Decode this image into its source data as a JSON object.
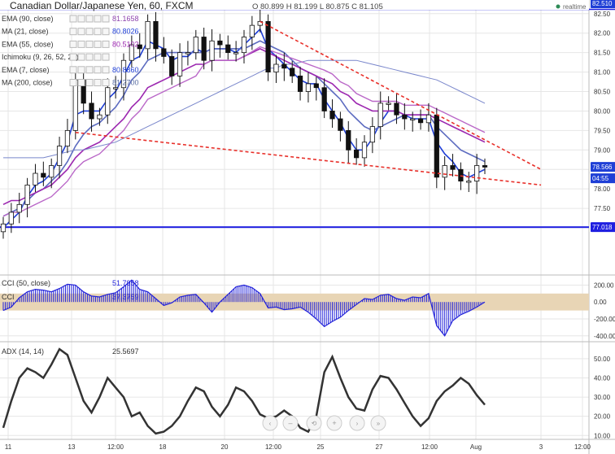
{
  "header": {
    "title": "Canadian Dollar/Japanese Yen, 60, FXCM",
    "ohlc_text": "O 80.899  H 81.199  L 80.875  C 81.105",
    "realtime_label": "realtime"
  },
  "indicators": [
    {
      "label": "EMA (90, close)",
      "value": "81.1658",
      "color": "#8e44ad"
    },
    {
      "label": "MA (21, close)",
      "value": "80.8026",
      "color": "#1f3fd6"
    },
    {
      "label": "EMA (55, close)",
      "value": "80.5102",
      "color": "#9c27b0"
    },
    {
      "label": "Ichimoku (9, 26, 52, 26)",
      "value": "",
      "color": "#999999"
    },
    {
      "label": "EMA (7, close)",
      "value": "80.8860",
      "color": "#1f3fd6"
    },
    {
      "label": "MA (200, close)",
      "value": "81.2700",
      "color": "#5b6fa3"
    }
  ],
  "price_badges": {
    "top": "82.510",
    "current": "78.566",
    "countdown": "04:55",
    "support": "77.018"
  },
  "cci": {
    "label": "CCI (50, close)",
    "value": "51.7958",
    "label2": "CCI",
    "value2": "37.3759"
  },
  "adx": {
    "label": "ADX (14, 14)",
    "value": "25.5697"
  },
  "colors": {
    "candle_up": "#111111",
    "candle_down": "#111111",
    "ema7": "#1f3fd6",
    "ma21": "#5c6bc0",
    "ema55": "#9c27b0",
    "ema90": "#ba68c8",
    "ma200": "#7986cb",
    "trendline": "#e8302a",
    "support_line": "#1f1fe0",
    "cci_band": "#e8d5b5",
    "cci_bars": "#2323d9",
    "adx_line": "#333333",
    "grid": "#e6e6e6"
  },
  "chart_data": [
    {
      "type": "line",
      "title": "Canadian Dollar/Japanese Yen, 60, FXCM",
      "x": [
        0,
        1,
        2,
        3,
        4,
        5,
        6,
        7,
        8,
        9,
        10,
        11,
        12,
        13,
        14,
        15,
        16,
        17,
        18,
        19,
        20,
        21,
        22,
        23,
        24,
        25,
        26,
        27,
        28,
        29,
        30,
        31,
        32,
        33,
        34,
        35,
        36,
        37,
        38,
        39,
        40,
        41,
        42,
        43,
        44,
        45,
        46,
        47,
        48,
        49,
        50,
        51,
        52,
        53,
        54,
        55,
        56,
        57,
        58,
        59,
        60
      ],
      "x_tick_labels": [
        "11",
        "13",
        "12:00",
        "18",
        "20",
        "12:00",
        "25",
        "27",
        "12:00",
        "Aug",
        "3",
        "12:00"
      ],
      "ylim": [
        76.75,
        82.6
      ],
      "y_ticks": [
        77.0,
        77.5,
        78.0,
        78.5,
        79.0,
        79.5,
        80.0,
        80.5,
        81.0,
        81.5,
        82.0,
        82.5
      ],
      "series": [
        {
          "name": "close",
          "values": [
            77.1,
            77.4,
            77.6,
            78.1,
            78.4,
            78.3,
            78.6,
            79.1,
            79.5,
            80.8,
            80.2,
            79.8,
            79.9,
            80.6,
            80.6,
            81.3,
            81.7,
            81.6,
            82.3,
            81.6,
            81.4,
            80.9,
            81.5,
            81.5,
            81.9,
            81.3,
            81.8,
            81.7,
            81.5,
            81.5,
            81.9,
            82.2,
            82.3,
            81.0,
            81.2,
            81.1,
            80.9,
            80.5,
            80.7,
            80.6,
            80.0,
            79.8,
            79.5,
            79.0,
            78.8,
            79.2,
            79.6,
            80.2,
            80.2,
            79.9,
            79.8,
            79.8,
            79.7,
            79.9,
            78.3,
            78.6,
            78.5,
            78.2,
            78.2,
            78.6,
            78.56
          ]
        },
        {
          "name": "EMA (7, close)",
          "values": [
            77.0,
            77.2,
            77.4,
            77.8,
            78.1,
            78.2,
            78.4,
            78.8,
            79.2,
            79.9,
            80.0,
            80.0,
            80.0,
            80.3,
            80.5,
            80.9,
            81.3,
            81.4,
            81.8,
            81.7,
            81.6,
            81.3,
            81.4,
            81.4,
            81.6,
            81.5,
            81.6,
            81.6,
            81.6,
            81.5,
            81.7,
            81.9,
            82.1,
            81.6,
            81.4,
            81.2,
            81.0,
            80.8,
            80.7,
            80.7,
            80.3,
            80.0,
            79.7,
            79.3,
            79.0,
            79.0,
            79.3,
            79.7,
            80.0,
            80.0,
            79.9,
            79.8,
            79.8,
            79.8,
            79.2,
            78.9,
            78.7,
            78.4,
            78.3,
            78.4,
            78.5
          ]
        },
        {
          "name": "MA (21, close)",
          "values": [
            77.3,
            77.4,
            77.5,
            77.7,
            77.9,
            78.0,
            78.2,
            78.4,
            78.7,
            79.1,
            79.4,
            79.6,
            79.7,
            79.9,
            80.1,
            80.4,
            80.8,
            81.0,
            81.3,
            81.4,
            81.5,
            81.5,
            81.5,
            81.5,
            81.5,
            81.5,
            81.6,
            81.6,
            81.6,
            81.6,
            81.6,
            81.7,
            81.8,
            81.7,
            81.6,
            81.5,
            81.3,
            81.1,
            81.0,
            80.9,
            80.7,
            80.5,
            80.3,
            80.0,
            79.8,
            79.6,
            79.5,
            79.6,
            79.7,
            79.8,
            79.9,
            79.9,
            79.9,
            79.9,
            79.6,
            79.4,
            79.2,
            79.0,
            78.9,
            78.8,
            78.7
          ]
        },
        {
          "name": "EMA (55, close)",
          "values": [
            77.6,
            77.7,
            77.7,
            77.8,
            77.9,
            78.0,
            78.1,
            78.3,
            78.5,
            78.8,
            79.0,
            79.1,
            79.2,
            79.4,
            79.6,
            79.8,
            80.1,
            80.3,
            80.6,
            80.7,
            80.8,
            80.9,
            81.0,
            81.1,
            81.2,
            81.2,
            81.3,
            81.3,
            81.3,
            81.3,
            81.4,
            81.5,
            81.6,
            81.5,
            81.4,
            81.3,
            81.2,
            81.1,
            81.0,
            80.9,
            80.8,
            80.7,
            80.5,
            80.4,
            80.2,
            80.1,
            80.0,
            80.0,
            80.0,
            80.0,
            79.9,
            79.9,
            79.9,
            79.9,
            79.8,
            79.7,
            79.6,
            79.5,
            79.4,
            79.3,
            79.2
          ]
        },
        {
          "name": "MA (200, close)",
          "values": [
            78.8,
            78.8,
            78.8,
            78.8,
            78.8,
            78.8,
            78.85,
            78.9,
            78.95,
            79.0,
            79.0,
            79.05,
            79.1,
            79.15,
            79.2,
            79.3,
            79.4,
            79.5,
            79.6,
            79.7,
            79.8,
            79.9,
            80.0,
            80.1,
            80.2,
            80.3,
            80.4,
            80.5,
            80.6,
            80.7,
            80.8,
            80.9,
            81.0,
            81.1,
            81.1,
            81.2,
            81.2,
            81.25,
            81.3,
            81.3,
            81.3,
            81.3,
            81.3,
            81.3,
            81.3,
            81.25,
            81.2,
            81.15,
            81.1,
            81.05,
            81.0,
            80.95,
            80.9,
            80.85,
            80.8,
            80.7,
            80.6,
            80.5,
            80.4,
            80.3,
            80.2
          ]
        }
      ],
      "annotations": [
        {
          "type": "trendline",
          "from": [
            32,
            82.3
          ],
          "to": [
            67,
            78.5
          ]
        },
        {
          "type": "trendline",
          "from": [
            9,
            79.45
          ],
          "to": [
            67,
            78.1
          ]
        },
        {
          "type": "hline",
          "y": 77.018
        }
      ]
    },
    {
      "type": "bar",
      "title": "CCI (50, close)",
      "x": [
        0,
        1,
        2,
        3,
        4,
        5,
        6,
        7,
        8,
        9,
        10,
        11,
        12,
        13,
        14,
        15,
        16,
        17,
        18,
        19,
        20,
        21,
        22,
        23,
        24,
        25,
        26,
        27,
        28,
        29,
        30,
        31,
        32,
        33,
        34,
        35,
        36,
        37,
        38,
        39,
        40,
        41,
        42,
        43,
        44,
        45,
        46,
        47,
        48,
        49,
        50,
        51,
        52,
        53,
        54,
        55,
        56,
        57,
        58,
        59,
        60
      ],
      "ylim": [
        -450,
        300
      ],
      "y_ticks": [
        -400,
        -200,
        0,
        200
      ],
      "band": [
        -100,
        100
      ],
      "values": [
        -100,
        -60,
        50,
        120,
        150,
        140,
        120,
        160,
        210,
        200,
        120,
        70,
        60,
        90,
        110,
        180,
        260,
        150,
        120,
        40,
        -40,
        -10,
        60,
        80,
        90,
        -10,
        -120,
        0,
        90,
        180,
        200,
        170,
        100,
        -70,
        -60,
        -90,
        -80,
        -60,
        -120,
        -200,
        -290,
        -230,
        -180,
        -100,
        -30,
        40,
        30,
        80,
        90,
        40,
        20,
        60,
        50,
        100,
        -280,
        -400,
        -220,
        -150,
        -110,
        -60,
        0
      ]
    },
    {
      "type": "line",
      "title": "ADX (14, 14)",
      "x": [
        0,
        1,
        2,
        3,
        4,
        5,
        6,
        7,
        8,
        9,
        10,
        11,
        12,
        13,
        14,
        15,
        16,
        17,
        18,
        19,
        20,
        21,
        22,
        23,
        24,
        25,
        26,
        27,
        28,
        29,
        30,
        31,
        32,
        33,
        34,
        35,
        36,
        37,
        38,
        39,
        40,
        41,
        42,
        43,
        44,
        45,
        46,
        47,
        48,
        49,
        50,
        51,
        52,
        53,
        54,
        55,
        56,
        57,
        58,
        59,
        60
      ],
      "ylim": [
        8,
        58
      ],
      "y_ticks": [
        10,
        20,
        30,
        40,
        50
      ],
      "values": [
        14,
        28,
        40,
        45,
        43,
        40,
        47,
        55,
        52,
        40,
        28,
        22,
        30,
        40,
        35,
        30,
        20,
        22,
        15,
        11,
        12,
        15,
        20,
        28,
        35,
        33,
        25,
        20,
        26,
        35,
        33,
        28,
        21,
        19,
        20,
        23,
        20,
        14,
        12,
        20,
        43,
        51,
        40,
        30,
        24,
        23,
        34,
        41,
        40,
        34,
        27,
        20,
        15,
        19,
        28,
        33,
        36,
        40,
        37,
        31,
        26
      ]
    }
  ]
}
